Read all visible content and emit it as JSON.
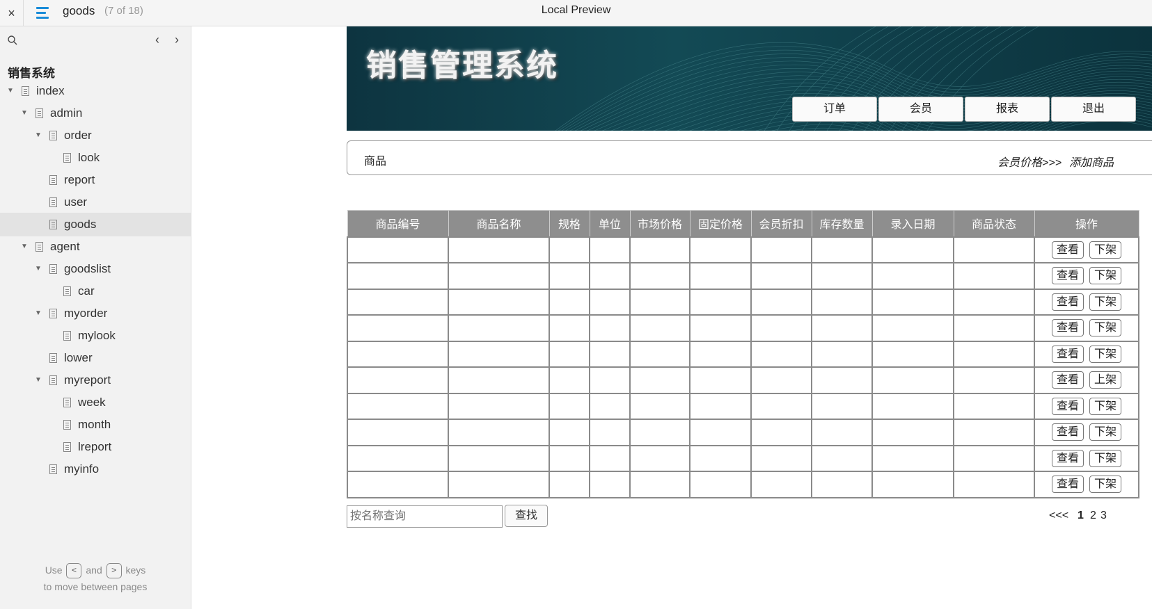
{
  "topbar": {
    "close_icon": "×",
    "doc_title": "goods",
    "doc_count": "(7 of 18)",
    "window_title": "Local Preview"
  },
  "sidebar": {
    "prev_icon": "‹",
    "next_icon": "›",
    "header": "销售系统",
    "items": [
      {
        "label": "index",
        "depth": 0,
        "expanded": true
      },
      {
        "label": "admin",
        "depth": 1,
        "expanded": true
      },
      {
        "label": "order",
        "depth": 2,
        "expanded": true
      },
      {
        "label": "look",
        "depth": 3
      },
      {
        "label": "report",
        "depth": 2
      },
      {
        "label": "user",
        "depth": 2
      },
      {
        "label": "goods",
        "depth": 2,
        "active": true
      },
      {
        "label": "agent",
        "depth": 1,
        "expanded": true
      },
      {
        "label": "goodslist",
        "depth": 2,
        "expanded": true
      },
      {
        "label": "car",
        "depth": 3
      },
      {
        "label": "myorder",
        "depth": 2,
        "expanded": true
      },
      {
        "label": "mylook",
        "depth": 3
      },
      {
        "label": "lower",
        "depth": 2
      },
      {
        "label": "myreport",
        "depth": 2,
        "expanded": true
      },
      {
        "label": "week",
        "depth": 3
      },
      {
        "label": "month",
        "depth": 3
      },
      {
        "label": "lreport",
        "depth": 3
      },
      {
        "label": "myinfo",
        "depth": 2
      }
    ],
    "hint": {
      "use": "Use",
      "key_prev": "<",
      "and": "and",
      "key_next": ">",
      "keys": "keys",
      "line2": "to move between pages"
    }
  },
  "banner": {
    "title": "销售管理系统",
    "nav": [
      "订单",
      "会员",
      "报表",
      "退出"
    ]
  },
  "crumb": {
    "title": "商品",
    "member_price_link": "会员价格>>>",
    "add_goods_link": "添加商品"
  },
  "table": {
    "headers": [
      "商品编号",
      "商品名称",
      "规格",
      "单位",
      "市场价格",
      "固定价格",
      "会员折扣",
      "库存数量",
      "录入日期",
      "商品状态",
      "操作"
    ],
    "rows": [
      {
        "view": "查看",
        "toggle": "下架"
      },
      {
        "view": "查看",
        "toggle": "下架"
      },
      {
        "view": "查看",
        "toggle": "下架"
      },
      {
        "view": "查看",
        "toggle": "下架"
      },
      {
        "view": "查看",
        "toggle": "下架"
      },
      {
        "view": "查看",
        "toggle": "上架"
      },
      {
        "view": "查看",
        "toggle": "下架"
      },
      {
        "view": "查看",
        "toggle": "下架"
      },
      {
        "view": "查看",
        "toggle": "下架"
      },
      {
        "view": "查看",
        "toggle": "下架"
      }
    ]
  },
  "search": {
    "placeholder": "按名称查询",
    "button": "查找"
  },
  "pager": {
    "prev": "<<<",
    "pages": [
      "1",
      "2",
      "3"
    ],
    "current": "1"
  }
}
